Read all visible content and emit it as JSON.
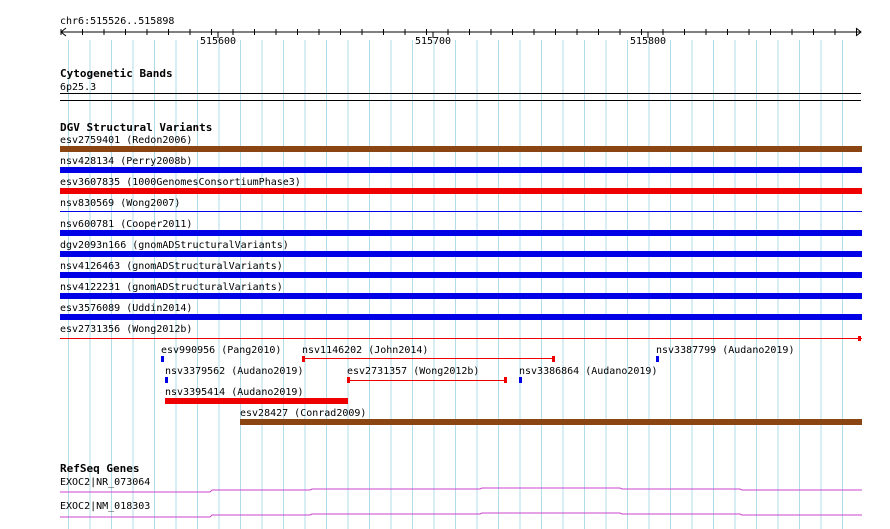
{
  "ruler": {
    "region": "chr6:515526..515898",
    "ticks": [
      "515600",
      "515700",
      "515800"
    ]
  },
  "tracks": {
    "cytoband": {
      "title": "Cytogenetic Bands",
      "band": "6p25.3"
    },
    "dgv": {
      "title": "DGV Structural Variants",
      "features": [
        {
          "label": "esv2759401 (Redon2006)",
          "color": "#8b4513",
          "style": "thick"
        },
        {
          "label": "nsv428134 (Perry2008b)",
          "color": "#0000e6",
          "style": "thick"
        },
        {
          "label": "esv3607835 (1000GenomesConsortiumPhase3)",
          "color": "#ee0000",
          "style": "thick"
        },
        {
          "label": "nsv830569 (Wong2007)",
          "color": "#0000e6",
          "style": "thin"
        },
        {
          "label": "nsv600781 (Cooper2011)",
          "color": "#0000e6",
          "style": "thick"
        },
        {
          "label": "dgv2093n166 (gnomADStructuralVariants)",
          "color": "#0000e6",
          "style": "thick"
        },
        {
          "label": "nsv4126463 (gnomADStructuralVariants)",
          "color": "#0000e6",
          "style": "thick"
        },
        {
          "label": "nsv4122231 (gnomADStructuralVariants)",
          "color": "#0000e6",
          "style": "thick"
        },
        {
          "label": "esv3576089 (Uddin2014)",
          "color": "#0000e6",
          "style": "thick"
        },
        {
          "label": "esv2731356 (Wong2012b)",
          "color": "#ee0000",
          "style": "thin-cap"
        }
      ],
      "small_features": [
        {
          "label": "esv990956 (Pang2010)",
          "color": "#0000e6"
        },
        {
          "label": "nsv1146202 (John2014)",
          "color": "#ee0000"
        },
        {
          "label": "nsv3387799 (Audano2019)",
          "color": "#0000e6"
        },
        {
          "label": "nsv3379562 (Audano2019)",
          "color": "#0000e6"
        },
        {
          "label": "esv2731357 (Wong2012b)",
          "color": "#ee0000"
        },
        {
          "label": "nsv3386864 (Audano2019)",
          "color": "#0000e6"
        },
        {
          "label": "nsv3395414 (Audano2019)",
          "color": "#ee0000"
        },
        {
          "label": "esv28427 (Conrad2009)",
          "color": "#8b4513"
        }
      ]
    },
    "refseq": {
      "title": "RefSeq Genes",
      "genes": [
        {
          "label": "EXOC2|NR_073064",
          "color": "#cc44cc"
        },
        {
          "label": "EXOC2|NM_018303",
          "color": "#cc44cc"
        }
      ]
    }
  }
}
